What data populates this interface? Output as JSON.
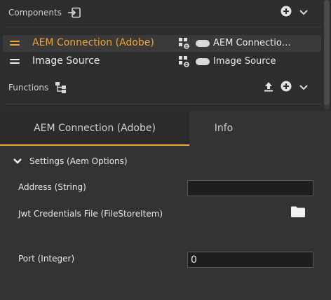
{
  "components_section": {
    "title": "Components",
    "title_icon": "import-icon",
    "actions": [
      "add-icon",
      "chevron-down-icon"
    ],
    "items": [
      {
        "name": "AEM Connection (Adobe)",
        "alias": "AEM Connectio…",
        "selected": true,
        "type_icon": "component-link-icon"
      },
      {
        "name": "Image Source",
        "alias": "Image Source",
        "selected": false,
        "type_icon": "component-link-icon"
      }
    ]
  },
  "functions_section": {
    "title": "Functions",
    "title_icon": "hierarchy-icon",
    "actions": [
      "upload-icon",
      "add-icon",
      "chevron-down-icon"
    ]
  },
  "tabs": [
    {
      "label": "AEM Connection (Adobe)",
      "active": true
    },
    {
      "label": "Info",
      "active": false
    }
  ],
  "settings": {
    "header": "Settings (Aem Options)",
    "fields": [
      {
        "label": "Address (String)",
        "value": "",
        "type": "text"
      },
      {
        "label": "Jwt Credentials File (FileStoreItem)",
        "value": "",
        "type": "file"
      },
      {
        "label": "Port (Integer)",
        "value": "0",
        "type": "text"
      }
    ]
  },
  "colors": {
    "accent": "#f2a531",
    "background": "#2f2f2f",
    "input_bg": "#1e1e1e"
  }
}
